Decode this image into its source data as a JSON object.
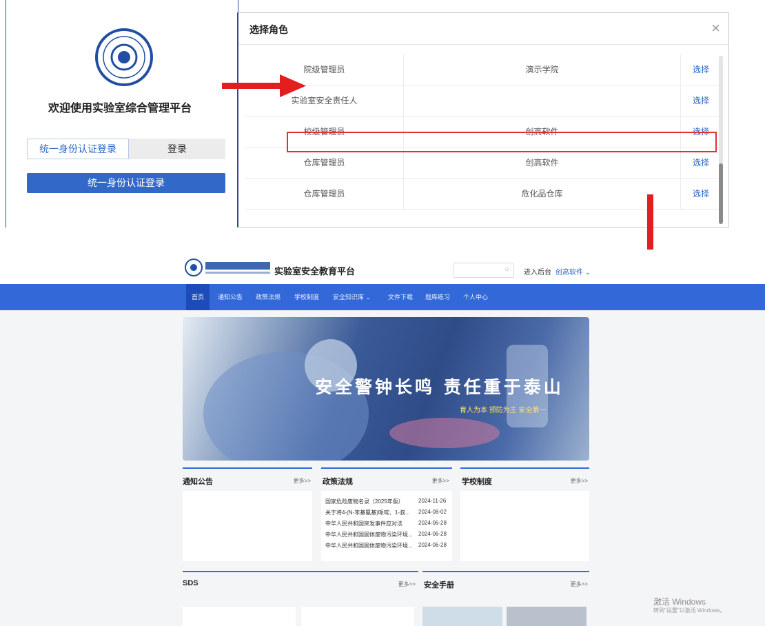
{
  "login": {
    "welcome": "欢迎使用实验室综合管理平台",
    "tab_sso": "统一身份认证登录",
    "tab_login": "登录",
    "sso_button": "统一身份认证登录"
  },
  "role_dialog": {
    "title": "选择角色",
    "close_icon": "close-icon",
    "rows": [
      {
        "role": "院级管理员",
        "org": "演示学院",
        "action": "选择"
      },
      {
        "role": "实验室安全责任人",
        "org": "",
        "action": "选择"
      },
      {
        "role": "校级管理员",
        "org": "创高软件",
        "action": "选择",
        "highlighted": true
      },
      {
        "role": "仓库管理员",
        "org": "创高软件",
        "action": "选择"
      },
      {
        "role": "仓库管理员",
        "org": "危化品仓库",
        "action": "选择"
      }
    ]
  },
  "portal": {
    "title": "实验室安全教育平台",
    "enter_backend": "进入后台",
    "user_menu": "创高软件 ⌄",
    "nav": [
      "首页",
      "通知公告",
      "政策法规",
      "学校制度",
      "安全知识库 ⌄",
      "文件下载",
      "题库练习",
      "个人中心"
    ],
    "banner": {
      "headline": "安全警钟长鸣 责任重于泰山",
      "sub": "育人为本   预防为主   安全第一"
    },
    "sections": {
      "notice": {
        "title": "通知公告",
        "more": "更多>>"
      },
      "policy": {
        "title": "政策法规",
        "more": "更多>>",
        "items": [
          {
            "text": "国家危险废物名录（2025年版）",
            "date": "2024-11-26"
          },
          {
            "text": "关于将4-(N-苯基氨基)哌啶、1-叔...",
            "date": "2024-08-02"
          },
          {
            "text": "中华人民共和国突发事件应对法",
            "date": "2024-06-28"
          },
          {
            "text": "中华人民共和国固体废物污染环境...",
            "date": "2024-06-28"
          },
          {
            "text": "中华人民共和国固体废物污染环境...",
            "date": "2024-06-28"
          }
        ]
      },
      "school": {
        "title": "学校制度",
        "more": "更多>>"
      },
      "sds": {
        "title": "SDS",
        "more": "更多>>"
      },
      "manual": {
        "title": "安全手册",
        "more": "更多>>"
      }
    }
  },
  "watermark": {
    "title": "激活 Windows",
    "sub": "转到\"设置\"以激活 Windows。"
  },
  "colors": {
    "accent": "#3268d8",
    "highlight": "#e03131",
    "link": "#2d66c6"
  }
}
